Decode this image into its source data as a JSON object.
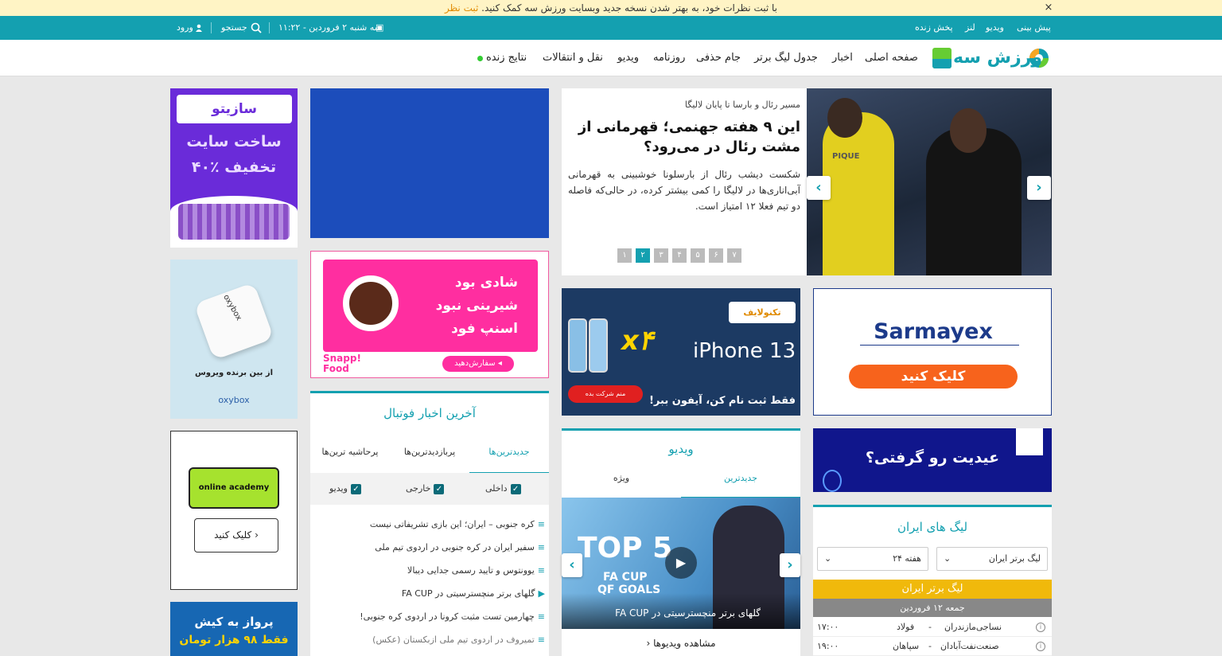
{
  "notice": {
    "text": "با ثبت نظرات خود، به بهتر شدن نسخه جدید وبسایت ورزش سه کمک کنید.",
    "link": "ثبت نظر",
    "close": "×"
  },
  "topbar": {
    "right_links": [
      "پیش بینی",
      "ویدیو",
      "لنز",
      "پخش زنده"
    ],
    "date": "سه شنبه ۲ فروردین - ۱۱:۲۲",
    "search": "جستجو",
    "login": "ورود"
  },
  "nav": {
    "logo": "ورزش سه",
    "items": [
      "صفحه اصلی",
      "اخبار",
      "جدول لیگ برتر",
      "جام حذفی",
      "روزنامه",
      "ویدیو",
      "نقل و انتقالات",
      "نتایج زنده"
    ]
  },
  "featured": {
    "kicker": "مسیر رئال و بارسا تا پایان لالیگا",
    "title": "این ۹ هفته جهنمی؛ قهرمانی از مشت رئال در می‌رود؟",
    "summary": "شکست دیشب رئال از بارسلونا خوشبینی به قهرمانی آبی‌اناری‌ها در لالیگا را کمی بیشتر کرده، در حالی‌که فاصله دو تیم فعلا ۱۲ امتیاز است.",
    "pages": [
      "۷",
      "۶",
      "۵",
      "۴",
      "۳",
      "۲",
      "۱"
    ],
    "active_page": "۲",
    "jersey": "PIQUE",
    "next": "›",
    "prev": "‹"
  },
  "ads": {
    "sazito_brand": "سازیتو",
    "sazito_line1": "ساخت سایت",
    "sazito_line2": "۴۰٪ تخفیف",
    "oxy_brand": "oxybox",
    "oxy_text": "از بین برنده ویروس",
    "snapp_text": "شادی بود شیرینی نبود اسنپ فود",
    "snapp_btn": "سفارش‌دهید ◂",
    "snapp_logo": "Snapp! Food",
    "iphone_title": "iPhone 13",
    "iphone_mult": "x۴",
    "iphone_brand": "تکنولایف",
    "iphone_tag": "فقط ثبت نام کن، آیفون ببر!",
    "iphone_btn": "منم شرکت بده",
    "sarmayex_brand": "Sarmayex",
    "sarmayex_btn": "کلیک کنید",
    "eid_text": "عیدیت رو گرفتی؟",
    "academy_brand": "online academy",
    "academy_btn": "کلیک کنید ›",
    "kish_text": "پرواز به کیش",
    "kish_price": "فقط ۹۸ هزار تومان"
  },
  "football": {
    "title": "آخرین اخبار فوتبال",
    "tabs": [
      "جدیدترین‌ها",
      "پربازدیدترین‌ها",
      "پرحاشیه ترین‌ها"
    ],
    "filters": [
      "داخلی",
      "خارجی",
      "ویدیو"
    ],
    "news": [
      "کره جنوبی – ایران؛ این بازی تشریفاتی نیست",
      "سفیر ایران در کره جنوبی در اردوی تیم ملی",
      "یوونتوس و تایید رسمی جدایی دیبالا",
      "گلهای برتر منچسترسیتی در FA CUP",
      "چهارمین تست مثبت کرونا در اردوی کره جنوبی!",
      "تمیروف در اردوی تیم ملی ازبکستان (عکس)"
    ]
  },
  "video": {
    "title": "ویدیو",
    "tabs": [
      "جدیدترین",
      "ویژه"
    ],
    "caption": "گلهای برتر منچسترسیتی در FA CUP",
    "thumb_top": "TOP 5",
    "thumb_sub1": "FA CUP",
    "thumb_sub2": "QF GOALS",
    "more": "مشاهده ویدیوها"
  },
  "league": {
    "title": "لیگ های ایران",
    "league_select": "لیگ برتر ایران",
    "week_select": "هفته ۲۴",
    "banner": "لیگ برتر ایران",
    "date": "جمعه ۱۲ فروردین",
    "matches": [
      {
        "home": "نساجی‌مازندران",
        "away": "فولاد",
        "time": "۱۷:۰۰"
      },
      {
        "home": "صنعت‌نفت‌آبادان",
        "away": "سپاهان",
        "time": "۱۹:۰۰"
      }
    ]
  }
}
